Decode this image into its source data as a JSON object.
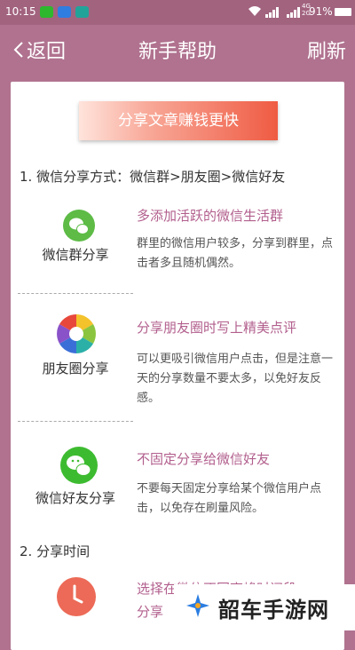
{
  "status_bar": {
    "time": "10:15",
    "network_label": "4G",
    "network_label2": "2G",
    "battery": "91%"
  },
  "header": {
    "back_label": "返回",
    "title": "新手帮助",
    "refresh_label": "刷新"
  },
  "banner": {
    "text": "分享文章赚钱更快"
  },
  "section1": {
    "title": "1. 微信分享方式：微信群>朋友圈>微信好友"
  },
  "items": [
    {
      "name": "微信群分享",
      "icon": "wechat-group-icon",
      "heading": "多添加活跃的微信生活群",
      "desc": "群里的微信用户较多，分享到群里，点击者多且随机偶然。"
    },
    {
      "name": "朋友圈分享",
      "icon": "moments-aperture-icon",
      "heading": "分享朋友圈时写上精美点评",
      "desc": "可以更吸引微信用户点击，但是注意一天的分享数量不要太多，以免好友反感。"
    },
    {
      "name": "微信好友分享",
      "icon": "wechat-icon",
      "heading": "不固定分享给微信好友",
      "desc": "不要每天固定分享给某个微信用户点击，以免存在刷量风险。"
    }
  ],
  "section2": {
    "title": "2. 分享时间",
    "heading_partial": "选择在微信不同高峰时间段",
    "line2_partial": "分享"
  },
  "watermark": {
    "text": "韶车手游网"
  },
  "colors": {
    "header_bg": "#b0728f",
    "accent_text": "#b25f8d",
    "banner_end": "#ef5b43"
  }
}
